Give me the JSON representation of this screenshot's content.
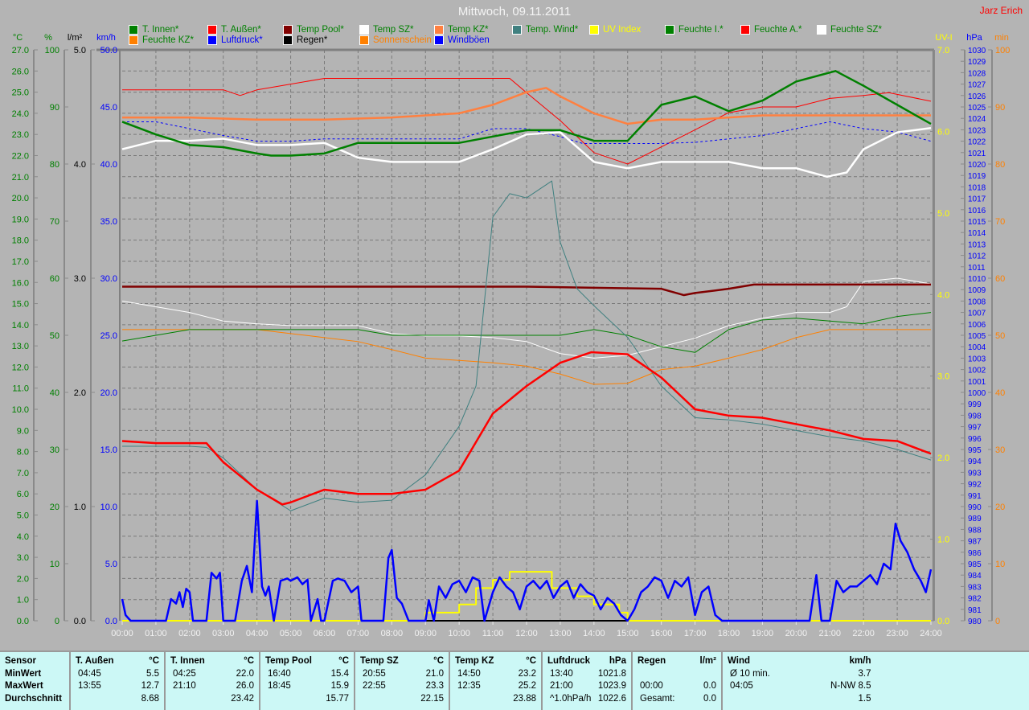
{
  "title": "Mittwoch, 09.11.2011",
  "owner": "Jarz Erich",
  "legend": [
    {
      "label": "T. Innen*",
      "swatch": "#008000",
      "text_color": "#008000"
    },
    {
      "label": "T. Außen*",
      "swatch": "#ff0000",
      "text_color": "#008000"
    },
    {
      "label": "Temp Pool*",
      "swatch": "#800000",
      "text_color": "#008000"
    },
    {
      "label": "Temp SZ*",
      "swatch": "#ffffff",
      "text_color": "#008000"
    },
    {
      "label": "Temp KZ*",
      "swatch": "#ff8040",
      "text_color": "#008000"
    },
    {
      "label": "Temp. Wind*",
      "swatch": "#408080",
      "text_color": "#008000"
    },
    {
      "label": "UV Index",
      "swatch": "#ffff00",
      "text_color": "#ffff00"
    },
    {
      "label": "Feuchte I.*",
      "swatch": "#008000",
      "text_color": "#008000"
    },
    {
      "label": "Feuchte A.*",
      "swatch": "#ff0000",
      "text_color": "#008000"
    },
    {
      "label": "Feuchte SZ*",
      "swatch": "#ffffff",
      "text_color": "#008000"
    },
    {
      "label": "Feuchte KZ*",
      "swatch": "#ff8000",
      "text_color": "#008000"
    },
    {
      "label": "Luftdruck*",
      "swatch": "#0000ff",
      "text_color": "#0000ff"
    },
    {
      "label": "Regen*",
      "swatch": "#000000",
      "text_color": "#000000"
    },
    {
      "label": "Sonnenschein",
      "swatch": "#ff8000",
      "text_color": "#ff8000"
    },
    {
      "label": "Windböen",
      "swatch": "#0000ff",
      "text_color": "#0000ff"
    }
  ],
  "chart_data": {
    "type": "line",
    "title": "Mittwoch, 09.11.2011",
    "x_ticks": [
      "00:00",
      "01:00",
      "02:00",
      "03:00",
      "04:00",
      "05:00",
      "06:00",
      "07:00",
      "08:00",
      "09:00",
      "10:00",
      "11:00",
      "12:00",
      "13:00",
      "14:00",
      "15:00",
      "16:00",
      "17:00",
      "18:00",
      "19:00",
      "20:00",
      "21:00",
      "22:00",
      "23:00",
      "24:00"
    ],
    "xlim": [
      0,
      24
    ],
    "grid": true,
    "axes": {
      "C": {
        "unit": "°C",
        "range": [
          0,
          27
        ],
        "step": 1,
        "decimals": 1,
        "color": "#008000",
        "side": "left"
      },
      "pct": {
        "unit": "%",
        "range": [
          0,
          100
        ],
        "step": 10,
        "decimals": 0,
        "color": "#008000",
        "side": "left"
      },
      "lm2": {
        "unit": "l/m²",
        "range": [
          0,
          5
        ],
        "step": 1,
        "decimals": 1,
        "color": "#000000",
        "side": "left"
      },
      "kmh": {
        "unit": "km/h",
        "range": [
          0,
          50
        ],
        "step": 5,
        "decimals": 1,
        "color": "#0000ff",
        "side": "left"
      },
      "uv": {
        "unit": "UV-I",
        "range": [
          0,
          7
        ],
        "step": 1,
        "decimals": 1,
        "color": "#ffff00",
        "side": "right"
      },
      "hpa": {
        "unit": "hPa",
        "range": [
          980,
          1030
        ],
        "step": 1,
        "decimals": 0,
        "color": "#0000ff",
        "side": "right"
      },
      "min": {
        "unit": "min",
        "range": [
          0,
          100
        ],
        "step": 10,
        "decimals": 0,
        "color": "#ff8000",
        "side": "right"
      }
    },
    "series": [
      {
        "name": "Feuchte KZ",
        "axis": "pct",
        "color": "#ff8000",
        "width": 1,
        "x": [
          0,
          2,
          4,
          5,
          6,
          7,
          8,
          9,
          10,
          11,
          12,
          13,
          14,
          15,
          16,
          17,
          18,
          19,
          20,
          21,
          22,
          23,
          24
        ],
        "y": [
          51,
          51,
          51,
          50.3,
          49.6,
          48.9,
          47.5,
          46,
          45.6,
          45.2,
          44.6,
          43.2,
          41.4,
          41.6,
          44,
          44.6,
          46,
          47.5,
          49.6,
          51,
          51,
          51,
          51
        ]
      },
      {
        "name": "Feuchte SZ",
        "axis": "pct",
        "color": "#ffffff",
        "width": 1,
        "x": [
          0,
          1,
          2,
          3,
          4,
          5,
          6,
          7,
          8,
          9,
          10,
          11,
          12,
          13,
          14,
          15,
          16,
          17,
          18,
          19,
          20,
          21,
          21.5,
          22,
          23,
          24
        ],
        "y": [
          56,
          55,
          54,
          52.5,
          52,
          51.7,
          51.7,
          51.7,
          50.3,
          49.9,
          49.9,
          49.6,
          48.9,
          46.8,
          46,
          46.5,
          48,
          49.5,
          51.7,
          53,
          54,
          54,
          55,
          59.4,
          60,
          59
        ]
      },
      {
        "name": "Feuchte I.",
        "axis": "pct",
        "color": "#008000",
        "width": 1,
        "x": [
          0,
          1,
          2,
          3,
          4,
          5,
          6,
          7,
          8,
          9,
          10,
          11,
          12,
          13,
          14,
          15,
          16,
          17,
          18,
          19,
          20,
          21,
          22,
          23,
          24
        ],
        "y": [
          49,
          50,
          51,
          51,
          51,
          51,
          51,
          51,
          50,
          50,
          50,
          50,
          50,
          50,
          51,
          50,
          48,
          47,
          51,
          52.7,
          53,
          52.5,
          52,
          53.3,
          54
        ]
      },
      {
        "name": "Feuchte A.",
        "axis": "pct",
        "color": "#ff0000",
        "width": 1,
        "x": [
          0,
          1,
          2,
          3,
          3.5,
          4,
          5,
          6,
          7,
          8,
          9,
          10,
          11,
          11.5,
          12,
          13,
          14,
          15,
          16,
          17,
          18,
          19,
          20,
          21,
          22,
          22.75,
          24
        ],
        "y": [
          93,
          93,
          93,
          93,
          92,
          93,
          94,
          95,
          95,
          95,
          95,
          95,
          95,
          95,
          92.5,
          87.6,
          82,
          80,
          83,
          86,
          89,
          90,
          90,
          91.5,
          92,
          92.5,
          91
        ]
      },
      {
        "name": "Luftdruck",
        "axis": "hpa",
        "color": "#0000ff",
        "width": 1,
        "dash": true,
        "x": [
          0,
          1,
          2,
          3,
          4,
          5,
          6,
          7,
          8,
          9,
          10,
          11,
          12,
          13,
          13.67,
          14,
          15,
          16,
          17,
          18,
          19,
          20,
          21,
          22,
          23,
          24
        ],
        "y": [
          1023.7,
          1023.7,
          1023.1,
          1022.5,
          1022.0,
          1022.0,
          1022.2,
          1022.2,
          1022.2,
          1022.2,
          1022.2,
          1023.1,
          1023.1,
          1022.4,
          1021.8,
          1021.8,
          1021.8,
          1021.8,
          1021.9,
          1022.2,
          1022.5,
          1023.1,
          1023.7,
          1023.1,
          1022.8,
          1022.0
        ]
      },
      {
        "name": "Temp Pool",
        "axis": "C",
        "color": "#800000",
        "width": 2.5,
        "x": [
          0,
          4,
          8,
          12,
          16,
          16.67,
          17,
          18,
          18.75,
          19,
          24
        ],
        "y": [
          15.8,
          15.8,
          15.8,
          15.8,
          15.7,
          15.4,
          15.5,
          15.7,
          15.9,
          15.9,
          15.9
        ]
      },
      {
        "name": "Temp. Wind",
        "axis": "C",
        "color": "#408080",
        "width": 1,
        "x": [
          0,
          1,
          2,
          2.5,
          3,
          4,
          5,
          6,
          7,
          8,
          9,
          10,
          10.5,
          11,
          11.5,
          12,
          12.75,
          13,
          13.5,
          14,
          15,
          16,
          17,
          18,
          19,
          20,
          21,
          22,
          23,
          24
        ],
        "y": [
          8.25,
          8.25,
          8.25,
          8.2,
          7.7,
          6.2,
          5.2,
          5.8,
          5.6,
          5.7,
          6.9,
          9.2,
          11.1,
          19.1,
          20.2,
          20.0,
          20.8,
          17.9,
          15.7,
          14.9,
          13.4,
          11.1,
          9.6,
          9.5,
          9.3,
          9.0,
          8.7,
          8.5,
          8.1,
          7.6
        ]
      },
      {
        "name": "Temp KZ",
        "axis": "C",
        "color": "#ff8040",
        "width": 2.5,
        "x": [
          0,
          2,
          4,
          6,
          8,
          10,
          11,
          12,
          12.58,
          13,
          14,
          15,
          16,
          17,
          18,
          19,
          20,
          22,
          24
        ],
        "y": [
          23.8,
          23.8,
          23.7,
          23.7,
          23.8,
          24.0,
          24.4,
          25.0,
          25.2,
          24.8,
          24.0,
          23.5,
          23.7,
          23.7,
          23.8,
          23.9,
          23.9,
          23.9,
          23.9
        ]
      },
      {
        "name": "Temp SZ",
        "axis": "C",
        "color": "#ffffff",
        "width": 2.5,
        "x": [
          0,
          1,
          2,
          3,
          4,
          5,
          6,
          7,
          8,
          9,
          10,
          11,
          12,
          13,
          14,
          15,
          16,
          17,
          18,
          19,
          20,
          20.92,
          21.5,
          22,
          23,
          24
        ],
        "y": [
          22.3,
          22.7,
          22.7,
          22.8,
          22.5,
          22.5,
          22.6,
          21.9,
          21.7,
          21.7,
          21.7,
          22.3,
          23.0,
          23.1,
          21.7,
          21.4,
          21.7,
          21.7,
          21.7,
          21.4,
          21.4,
          21.0,
          21.2,
          22.3,
          23.1,
          23.3
        ]
      },
      {
        "name": "T. Innen",
        "axis": "C",
        "color": "#008000",
        "width": 2.5,
        "x": [
          0,
          1,
          2,
          3,
          4,
          4.42,
          5,
          6,
          7,
          8,
          9,
          10,
          11,
          12,
          13,
          14,
          15,
          16,
          17,
          18,
          19,
          20,
          21.17,
          22,
          23,
          24
        ],
        "y": [
          23.6,
          23.0,
          22.5,
          22.4,
          22.1,
          22.0,
          22.0,
          22.1,
          22.6,
          22.6,
          22.6,
          22.6,
          22.9,
          23.2,
          23.2,
          22.7,
          22.7,
          24.4,
          24.8,
          24.1,
          24.6,
          25.5,
          26.0,
          25.3,
          24.4,
          23.5
        ]
      },
      {
        "name": "T. Außen",
        "axis": "C",
        "color": "#ff0000",
        "width": 2.5,
        "x": [
          0,
          1,
          2,
          2.5,
          3,
          4,
          4.75,
          5,
          6,
          7,
          8,
          9,
          10,
          11,
          12,
          13,
          13.92,
          15,
          16,
          17,
          18,
          19,
          20,
          21,
          22,
          23,
          24
        ],
        "y": [
          8.5,
          8.4,
          8.4,
          8.4,
          7.5,
          6.2,
          5.5,
          5.6,
          6.2,
          6.0,
          6.0,
          6.2,
          7.1,
          9.8,
          11.1,
          12.2,
          12.7,
          12.6,
          11.5,
          10.0,
          9.7,
          9.6,
          9.3,
          9.0,
          8.6,
          8.5,
          7.9
        ]
      },
      {
        "name": "Regen",
        "axis": "lm2",
        "color": "#000000",
        "width": 2,
        "x": [
          9,
          15
        ],
        "y": [
          0,
          0
        ]
      },
      {
        "name": "UV Index",
        "axis": "uv",
        "color": "#ffff00",
        "width": 2,
        "step": true,
        "x": [
          0,
          9,
          10,
          10.5,
          11,
          11.5,
          12,
          12.5,
          12.75,
          13.5,
          14,
          14.75,
          15,
          24
        ],
        "y": [
          0,
          0.1,
          0.2,
          0.4,
          0.5,
          0.6,
          0.6,
          0.6,
          0.4,
          0.3,
          0.2,
          0.1,
          0,
          0
        ]
      },
      {
        "name": "Windböen",
        "axis": "kmh",
        "color": "#0000ff",
        "width": 2.5,
        "x": [
          0,
          0.1,
          0.25,
          1.3,
          1.45,
          1.6,
          1.7,
          1.8,
          1.9,
          2.0,
          2.1,
          2.5,
          2.65,
          2.8,
          2.9,
          3.0,
          3.35,
          3.55,
          3.7,
          3.85,
          4.0,
          4.15,
          4.25,
          4.35,
          4.5,
          4.7,
          4.9,
          5.0,
          5.2,
          5.35,
          5.5,
          5.6,
          5.8,
          5.9,
          6.0,
          6.25,
          6.4,
          6.6,
          6.8,
          7.0,
          7.1,
          7.75,
          7.9,
          8.0,
          8.15,
          8.3,
          8.5,
          9.0,
          9.1,
          9.25,
          9.4,
          9.6,
          9.8,
          10.0,
          10.2,
          10.4,
          10.6,
          10.75,
          11.0,
          11.2,
          11.4,
          11.6,
          11.8,
          12.0,
          12.2,
          12.4,
          12.6,
          12.8,
          13.0,
          13.2,
          13.4,
          13.6,
          13.8,
          14.0,
          14.2,
          14.4,
          14.6,
          14.8,
          15.0,
          15.2,
          15.4,
          15.6,
          15.8,
          16.0,
          16.2,
          16.4,
          16.6,
          16.8,
          17.0,
          17.2,
          17.4,
          17.6,
          17.8,
          18.0,
          18.5,
          20.4,
          20.6,
          20.75,
          21.0,
          21.2,
          21.4,
          21.6,
          21.8,
          22.0,
          22.2,
          22.4,
          22.6,
          22.8,
          22.95,
          23.1,
          23.3,
          23.5,
          23.7,
          23.85,
          24
        ],
        "y": [
          1.9,
          0.5,
          0,
          0,
          1.9,
          1.5,
          2.5,
          1.2,
          2.8,
          2.5,
          0,
          0,
          4.2,
          3.7,
          4.2,
          0,
          0,
          3.5,
          4.8,
          2.5,
          10.5,
          3.0,
          2.2,
          3.0,
          0,
          3.5,
          3.7,
          3.5,
          3.8,
          3.2,
          3.6,
          0,
          1.9,
          0,
          0,
          3.5,
          3.7,
          3.5,
          2.5,
          3.0,
          0,
          0,
          5.5,
          6.2,
          2.0,
          1.5,
          0,
          0,
          1.8,
          0,
          3.0,
          2.0,
          3.2,
          3.5,
          2.5,
          3.8,
          3.5,
          0,
          2.5,
          3.8,
          3.0,
          2.5,
          1.0,
          3.0,
          3.5,
          2.8,
          3.5,
          2.0,
          3.0,
          3.5,
          2.0,
          3.2,
          2.5,
          2.2,
          1.0,
          2.0,
          1.5,
          0.5,
          0,
          1.0,
          2.5,
          3.0,
          3.8,
          3.5,
          2.0,
          3.5,
          3.0,
          3.8,
          0.5,
          2.5,
          3.0,
          0.5,
          0,
          0,
          0,
          0,
          4.0,
          0,
          0,
          3.5,
          2.5,
          3.0,
          3.0,
          3.5,
          4.0,
          3.2,
          5.0,
          4.5,
          8.5,
          7.0,
          6.0,
          4.5,
          3.5,
          2.5,
          4.5
        ]
      }
    ]
  },
  "stats": {
    "sensor_col": [
      "Sensor",
      "MinWert",
      "MaxWert",
      "Durchschnitt"
    ],
    "groups": [
      {
        "name": "T. Außen",
        "unit": "°C",
        "min_time": "04:45",
        "min": "5.5",
        "max_time": "13:55",
        "max": "12.7",
        "avg_label": "",
        "avg": "8.68"
      },
      {
        "name": "T. Innen",
        "unit": "°C",
        "min_time": "04:25",
        "min": "22.0",
        "max_time": "21:10",
        "max": "26.0",
        "avg_label": "",
        "avg": "23.42"
      },
      {
        "name": "Temp Pool",
        "unit": "°C",
        "min_time": "16:40",
        "min": "15.4",
        "max_time": "18:45",
        "max": "15.9",
        "avg_label": "",
        "avg": "15.77"
      },
      {
        "name": "Temp SZ",
        "unit": "°C",
        "min_time": "20:55",
        "min": "21.0",
        "max_time": "22:55",
        "max": "23.3",
        "avg_label": "",
        "avg": "22.15"
      },
      {
        "name": "Temp KZ",
        "unit": "°C",
        "min_time": "14:50",
        "min": "23.2",
        "max_time": "12:35",
        "max": "25.2",
        "avg_label": "",
        "avg": "23.88"
      },
      {
        "name": "Luftdruck",
        "unit": "hPa",
        "min_time": "13:40",
        "min": "1021.8",
        "max_time": "21:00",
        "max": "1023.9",
        "avg_label": "^1.0hPa/h",
        "avg": "1022.6"
      },
      {
        "name": "Regen",
        "unit": "l/m²",
        "min_time": "",
        "min": "",
        "max_time": "00:00",
        "max": "0.0",
        "avg_label": "Gesamt:",
        "avg": "0.0"
      },
      {
        "name": "Wind",
        "unit": "km/h",
        "min_time": "Ø 10 min.",
        "min": "3.7",
        "max_time": "04:05",
        "max": "N-NW 8.5",
        "avg_label": "",
        "avg": "1.5"
      }
    ]
  }
}
